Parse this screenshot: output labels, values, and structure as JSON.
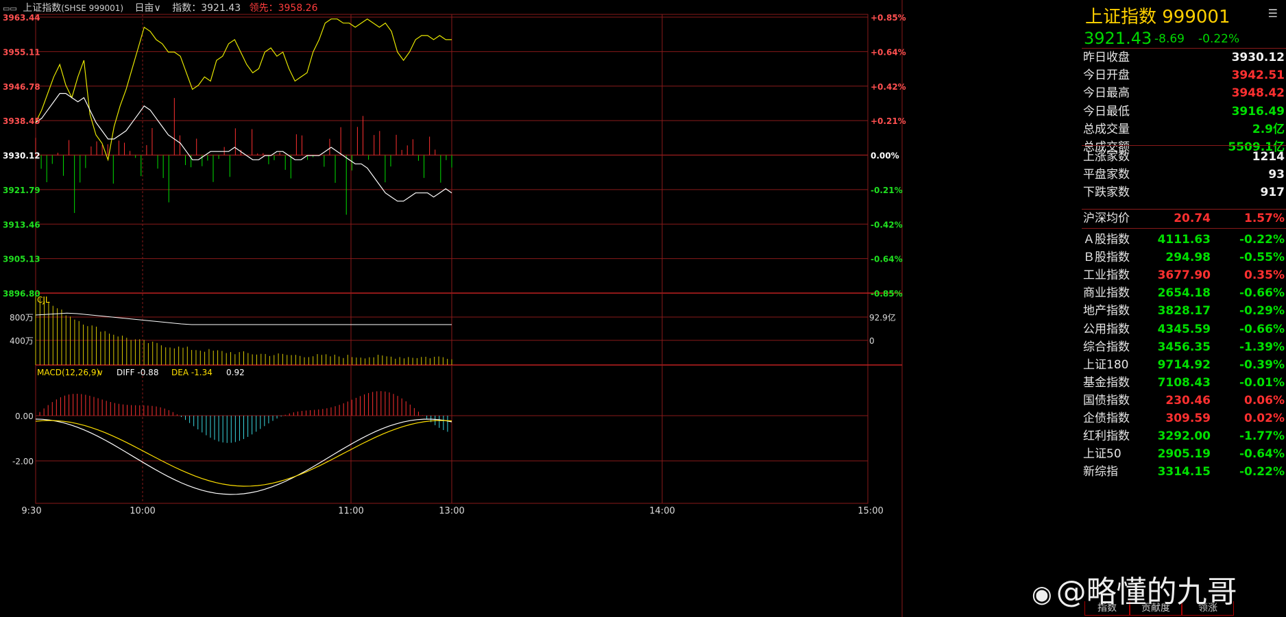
{
  "titlebar": {
    "icon": "chart-toggle-icon",
    "name": "上证指数",
    "code": "(SHSE 999001)",
    "period": "日亩",
    "index_label": "指数：3921.43",
    "lead_label": "领先：3958.26"
  },
  "price_axis_left": [
    "3963.44",
    "3955.11",
    "3946.78",
    "3938.45",
    "3930.12",
    "3921.79",
    "3913.46",
    "3905.13",
    "3896.80"
  ],
  "price_axis_right": [
    "+0.85%",
    "+0.64%",
    "+0.42%",
    "+0.21%",
    "0.00%",
    "-0.21%",
    "-0.42%",
    "-0.64%",
    "-0.85%"
  ],
  "volume_panel": {
    "label": "CJL",
    "left_ticks": [
      "800万",
      "400万"
    ],
    "right_ticks": [
      "92.9亿",
      "0"
    ]
  },
  "macd_panel": {
    "label": "MACD(12,26,9)",
    "diff": "DIFF -0.88",
    "dea": "DEA -1.34",
    "macd": "0.92",
    "ticks": [
      "0.00",
      "-2.00"
    ]
  },
  "time_axis": [
    "9:30",
    "10:00",
    "11:00",
    "13:00",
    "14:00",
    "15:00"
  ],
  "colors": {
    "up": "#ff3030",
    "down": "#00e000",
    "grid": "#8a1a1a",
    "price": "#e8e800",
    "avg": "#ffffff",
    "cyan": "#3ad8e0"
  },
  "chart_data": {
    "type": "line",
    "title": "上证指数 999001",
    "prev_close": 3930.12,
    "ylim": [
      3896.8,
      3963.44
    ],
    "x_range": [
      "9:30",
      "15:00"
    ],
    "series": [
      {
        "name": "price",
        "values": [
          3938,
          3941,
          3945,
          3949,
          3952,
          3947,
          3944,
          3949,
          3953,
          3940,
          3935,
          3933,
          3929,
          3937,
          3942,
          3946,
          3951,
          3956,
          3961,
          3960,
          3958,
          3957,
          3955,
          3955,
          3954,
          3950,
          3946,
          3947,
          3949,
          3948,
          3953,
          3954,
          3957,
          3958,
          3955,
          3952,
          3950,
          3951,
          3955,
          3956,
          3954,
          3955,
          3951,
          3948,
          3949,
          3950,
          3955,
          3958,
          3962,
          3963,
          3963,
          3962,
          3962,
          3961,
          3962,
          3963,
          3962,
          3961,
          3962,
          3960,
          3955,
          3953,
          3955,
          3958,
          3959,
          3959,
          3958,
          3959,
          3958,
          3958
        ]
      },
      {
        "name": "avg",
        "values": [
          3938,
          3939,
          3941,
          3943,
          3945,
          3945,
          3944,
          3943,
          3944,
          3941,
          3938,
          3936,
          3934,
          3934,
          3935,
          3936,
          3938,
          3940,
          3942,
          3941,
          3939,
          3937,
          3935,
          3934,
          3933,
          3931,
          3929,
          3929,
          3930,
          3931,
          3931,
          3931,
          3931,
          3932,
          3931,
          3930,
          3929,
          3929,
          3930,
          3930,
          3931,
          3931,
          3930,
          3929,
          3929,
          3930,
          3930,
          3930,
          3931,
          3932,
          3931,
          3930,
          3929,
          3928,
          3928,
          3927,
          3925,
          3923,
          3921,
          3920,
          3919,
          3919,
          3920,
          3921,
          3921,
          3921,
          3920,
          3921,
          3922,
          3921
        ]
      }
    ]
  },
  "quote_panel": {
    "title": "上证指数  999001",
    "menu_icon": "menu-icon",
    "price": "3921.43",
    "change": "-8.69",
    "change_pct": "-0.22%",
    "stats": [
      {
        "label": "昨日收盘",
        "value": "3930.12",
        "color": "white"
      },
      {
        "label": "今日开盘",
        "value": "3942.51",
        "color": "red"
      },
      {
        "label": "今日最高",
        "value": "3948.42",
        "color": "red"
      },
      {
        "label": "今日最低",
        "value": "3916.49",
        "color": "green"
      },
      {
        "label": "总成交量",
        "value": "2.9亿",
        "color": "green"
      },
      {
        "label": "总成交额",
        "value": "5509.1亿",
        "color": "green"
      }
    ],
    "breadth": [
      {
        "label": "上涨家数",
        "value": "1214",
        "color": "white"
      },
      {
        "label": "平盘家数",
        "value": "93",
        "color": "white"
      },
      {
        "label": "下跌家数",
        "value": "917",
        "color": "white"
      }
    ],
    "hs_avg": {
      "label": "沪深均价",
      "value": "20.74",
      "pct": "1.57%"
    },
    "indices": [
      {
        "label": "Ａ股指数",
        "value": "4111.63",
        "pct": "-0.22%",
        "color": "green"
      },
      {
        "label": "Ｂ股指数",
        "value": "294.98",
        "pct": "-0.55%",
        "color": "green"
      },
      {
        "label": "工业指数",
        "value": "3677.90",
        "pct": "0.35%",
        "color": "red"
      },
      {
        "label": "商业指数",
        "value": "2654.18",
        "pct": "-0.66%",
        "color": "green"
      },
      {
        "label": "地产指数",
        "value": "3828.17",
        "pct": "-0.29%",
        "color": "green"
      },
      {
        "label": "公用指数",
        "value": "4345.59",
        "pct": "-0.66%",
        "color": "green"
      },
      {
        "label": "综合指数",
        "value": "3456.35",
        "pct": "-1.39%",
        "color": "green"
      },
      {
        "label": "上证180",
        "value": "9714.92",
        "pct": "-0.39%",
        "color": "green"
      },
      {
        "label": "基金指数",
        "value": "7108.43",
        "pct": "-0.01%",
        "color": "green"
      },
      {
        "label": "国债指数",
        "value": "230.46",
        "pct": "0.06%",
        "color": "red"
      },
      {
        "label": "企债指数",
        "value": "309.59",
        "pct": "0.02%",
        "color": "red"
      },
      {
        "label": "红利指数",
        "value": "3292.00",
        "pct": "-1.77%",
        "color": "green"
      },
      {
        "label": "上证50",
        "value": "2905.19",
        "pct": "-0.64%",
        "color": "green"
      },
      {
        "label": "新综指",
        "value": "3314.15",
        "pct": "-0.22%",
        "color": "green"
      }
    ],
    "tabs": [
      "指数",
      "贡献度",
      "领涨"
    ]
  },
  "watermark": {
    "icon": "weibo-icon",
    "text": "@略懂的九哥"
  }
}
